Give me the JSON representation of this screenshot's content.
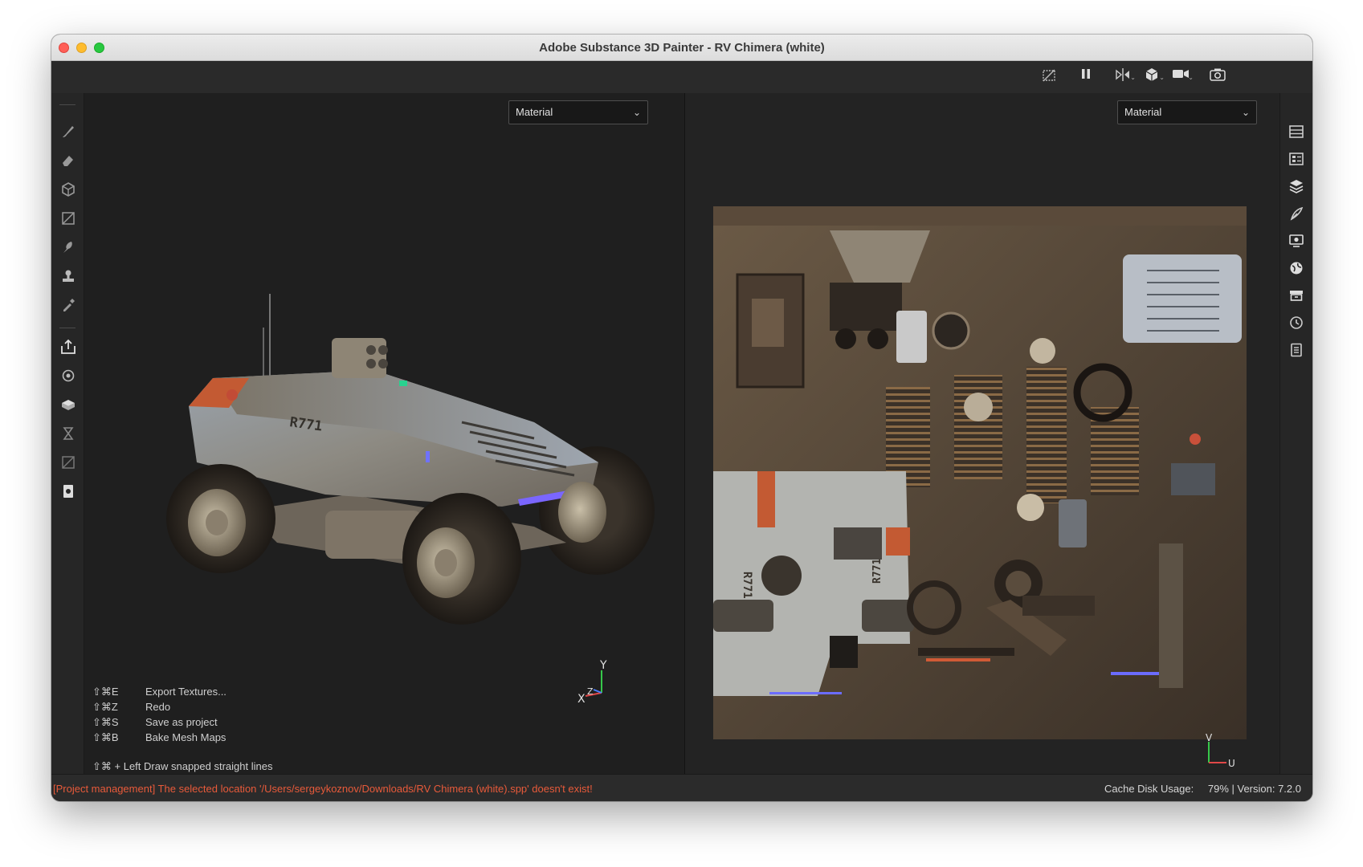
{
  "window": {
    "title": "Adobe Substance 3D Painter - RV Chimera (white)"
  },
  "top_toolbar": {
    "icons": [
      "hide-overlay-icon",
      "pause-icon",
      "symmetry-icon",
      "display-mode-icon",
      "camera-icon",
      "screenshot-icon"
    ]
  },
  "left_toolbar": {
    "tools": [
      "paint-brush-icon",
      "eraser-icon",
      "projection-icon",
      "polygon-fill-icon",
      "smudge-icon",
      "clone-stamp-icon",
      "color-picker-icon",
      "export-icon",
      "bake-icon",
      "geometry-mask-icon",
      "timer-icon",
      "uv-tool-icon",
      "viewport-capture-icon"
    ]
  },
  "right_toolbar": {
    "panels": [
      "layers-panel-icon",
      "texture-set-list-icon",
      "texture-set-settings-icon",
      "properties-icon",
      "display-settings-icon",
      "environment-icon",
      "assets-icon",
      "history-icon",
      "log-icon"
    ]
  },
  "viewport_3d": {
    "channel_dropdown": "Material",
    "mesh_decal": "R771",
    "gizmo": {
      "y": "Y",
      "x": "X",
      "z": "Z"
    },
    "shortcuts": [
      {
        "key": "⇧⌘E",
        "label": "Export Textures..."
      },
      {
        "key": "⇧⌘Z",
        "label": "Redo"
      },
      {
        "key": "⇧⌘S",
        "label": "Save as project"
      },
      {
        "key": "⇧⌘B",
        "label": "Bake Mesh Maps"
      }
    ],
    "shortcut_extra": {
      "key": "⇧⌘ + Left",
      "label": "Draw snapped straight lines"
    }
  },
  "viewport_2d": {
    "channel_dropdown": "Material",
    "uv_axes": {
      "v": "V",
      "u": "U"
    },
    "decal_texts": [
      "R771",
      "R771"
    ]
  },
  "status_bar": {
    "message": "[Project management] The selected location '/Users/sergeykoznov/Downloads/RV Chimera (white).spp' doesn't exist!",
    "cache_label": "Cache Disk Usage:",
    "cache_value": "79% | Version: 7.2.0"
  },
  "colors": {
    "error": "#e85a3a",
    "panel_bg": "#262626",
    "viewport_bg": "#1f1f1f"
  }
}
